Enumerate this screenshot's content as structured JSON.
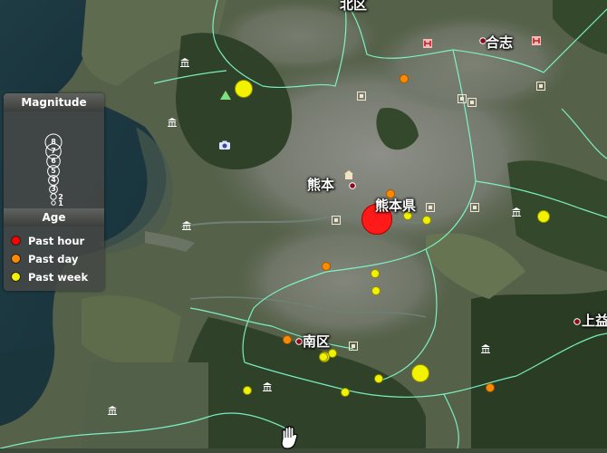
{
  "map": {
    "labels": [
      {
        "id": "kita-ku",
        "text": "北区"
      },
      {
        "id": "koshi",
        "text": "合志"
      },
      {
        "id": "kumamoto-city",
        "text": "熊本"
      },
      {
        "id": "kumamoto-pref",
        "text": "熊本県"
      },
      {
        "id": "minami-ku",
        "text": "南区"
      },
      {
        "id": "kamimashiki",
        "text": "上益"
      }
    ]
  },
  "legend": {
    "magnitude_title": "Magnitude",
    "magnitude_levels": [
      "8",
      "7",
      "6",
      "5",
      "4",
      "3",
      "2",
      "1"
    ],
    "age_title": "Age",
    "age_items": [
      {
        "label": "Past hour",
        "color": "#ff0000"
      },
      {
        "label": "Past day",
        "color": "#ff8a00"
      },
      {
        "label": "Past week",
        "color": "#f2f200"
      }
    ]
  },
  "quakes": [
    {
      "age": "hour",
      "magnitude": 4.3
    },
    {
      "age": "day",
      "magnitude": 2.4
    },
    {
      "age": "day",
      "magnitude": 2.2
    },
    {
      "age": "day",
      "magnitude": 2.4
    },
    {
      "age": "day",
      "magnitude": 2.2
    },
    {
      "age": "day",
      "magnitude": 2.4
    },
    {
      "age": "week",
      "magnitude": 3.2
    },
    {
      "age": "week",
      "magnitude": 2.4
    },
    {
      "age": "week",
      "magnitude": 2.4
    },
    {
      "age": "week",
      "magnitude": 2.7
    },
    {
      "age": "week",
      "magnitude": 2.3
    },
    {
      "age": "week",
      "magnitude": 2.3
    },
    {
      "age": "week",
      "magnitude": 2.3
    },
    {
      "age": "week",
      "magnitude": 2.5
    },
    {
      "age": "week",
      "magnitude": 2.4
    },
    {
      "age": "week",
      "magnitude": 3.2
    },
    {
      "age": "week",
      "magnitude": 2.3
    },
    {
      "age": "week",
      "magnitude": 2.3
    },
    {
      "age": "week",
      "magnitude": 2.3
    }
  ],
  "colors": {
    "hour": "#ff1a1a",
    "day": "#ff8a00",
    "week": "#f2f200",
    "boundary": "#7fffcf"
  }
}
